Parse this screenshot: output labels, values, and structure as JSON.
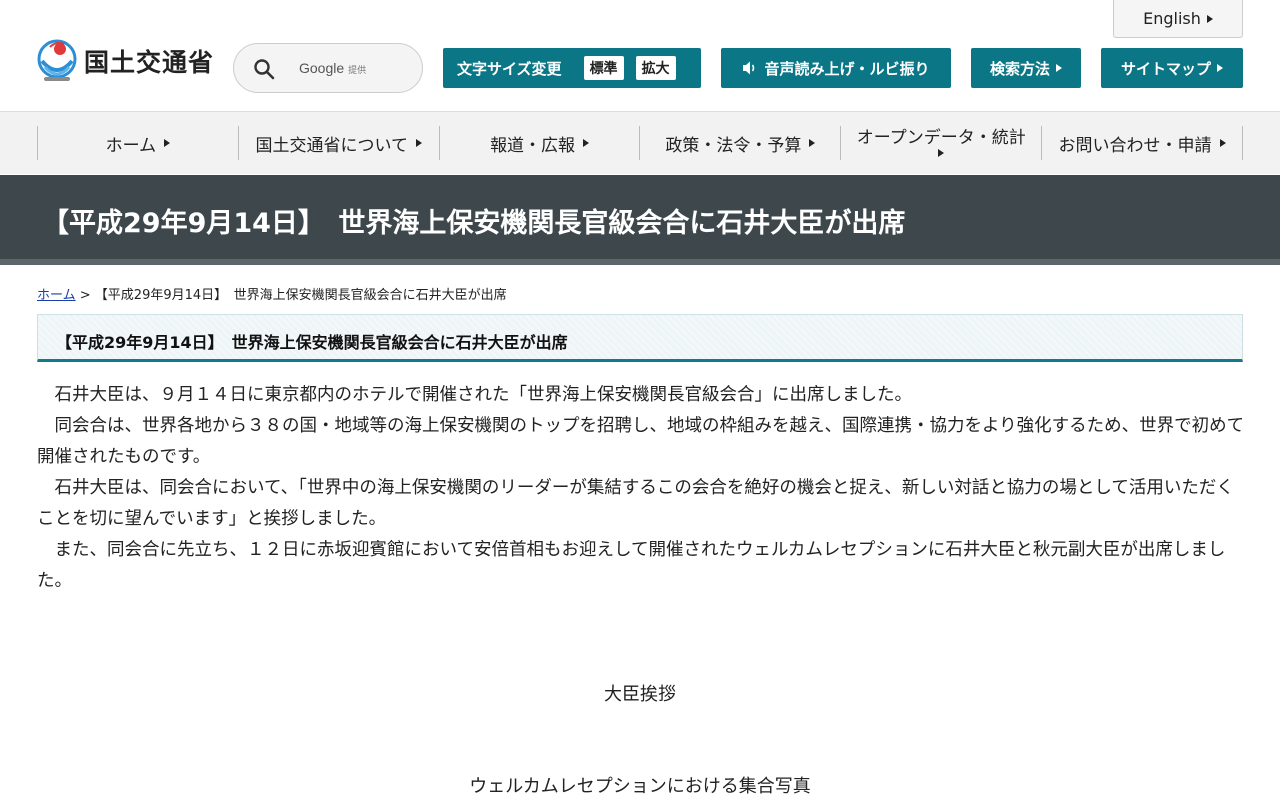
{
  "header": {
    "english_label": "English",
    "logo_text": "国土交通省",
    "search": {
      "provider": "Google",
      "provider_sub": "提供",
      "placeholder": ""
    },
    "fontsize": {
      "label": "文字サイズ変更",
      "standard": "標準",
      "large": "拡大"
    },
    "voice_label": "音声読み上げ・ルビ振り",
    "howto_label": "検索方法",
    "sitemap_label": "サイトマップ",
    "accent_color": "#0b7686"
  },
  "nav": {
    "items": [
      {
        "label": "ホーム"
      },
      {
        "label": "国土交通省について"
      },
      {
        "label": "報道・広報"
      },
      {
        "label": "政策・法令・予算"
      },
      {
        "label": "オープンデータ・統計"
      },
      {
        "label": "お問い合わせ・申請"
      }
    ]
  },
  "page": {
    "title": "【平成29年9月14日】　世界海上保安機関長官級会合に石井大臣が出席",
    "breadcrumb": {
      "home": "ホーム",
      "separator": " > ",
      "current": "【平成29年9月14日】　世界海上保安機関長官級会合に石井大臣が出席"
    },
    "section_title": "【平成29年9月14日】　世界海上保安機関長官級会合に石井大臣が出席",
    "paragraphs": [
      "石井大臣は、９月１４日に東京都内のホテルで開催された「世界海上保安機関長官級会合」に出席しました。",
      "同会合は、世界各地から３８の国・地域等の海上保安機関のトップを招聘し、地域の枠組みを越え、国際連携・協力をより強化するため、世界で初めて開催されたものです。",
      "石井大臣は、同会合において、「世界中の海上保安機関のリーダーが集結するこの会合を絶好の機会と捉え、新しい対話と協力の場として活用いただくことを切に望んでいます」と挨拶しました。",
      "また、同会合に先立ち、１２日に赤坂迎賓館において安倍首相もお迎えして開催されたウェルカムレセプションに石井大臣と秋元副大臣が出席しました。"
    ],
    "captions": [
      "大臣挨拶",
      "ウェルカムレセプションにおける集合写真"
    ]
  }
}
